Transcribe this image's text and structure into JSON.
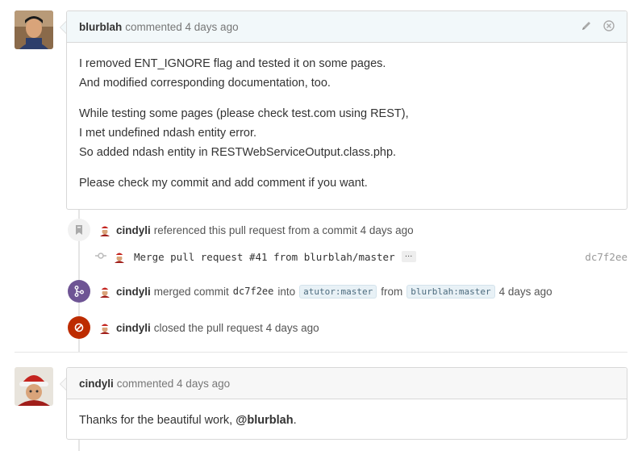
{
  "comment1": {
    "author": "blurblah",
    "meta": "commented 4 days ago",
    "paragraphs": [
      [
        "I removed ENT_IGNORE flag and tested it on some pages.",
        "And modified corresponding documentation, too."
      ],
      [
        "While testing some pages (please check test.com using REST),",
        "I met undefined ndash entity error.",
        "So added ndash entity in RESTWebServiceOutput.class.php."
      ],
      [
        "Please check my commit and add comment if you want."
      ]
    ]
  },
  "events": {
    "referenced": {
      "author": "cindyli",
      "text": "referenced this pull request from a commit 4 days ago"
    },
    "commit": {
      "message": "Merge pull request #41 from blurblah/master",
      "ellipsis": "…",
      "sha": "dc7f2ee"
    },
    "merged": {
      "author": "cindyli",
      "text1": "merged commit",
      "sha": "dc7f2ee",
      "text2": "into",
      "base": "atutor:master",
      "text3": "from",
      "head": "blurblah:master",
      "time": "4 days ago"
    },
    "closed": {
      "author": "cindyli",
      "text": "closed the pull request 4 days ago"
    }
  },
  "comment2": {
    "author": "cindyli",
    "meta": "commented 4 days ago",
    "body_prefix": "Thanks for the beautiful work, ",
    "mention": "@blurblah",
    "body_suffix": "."
  },
  "colors": {
    "merged": "#6e5494",
    "closed": "#bd2c00",
    "header_bg": "#f2f8fa"
  }
}
